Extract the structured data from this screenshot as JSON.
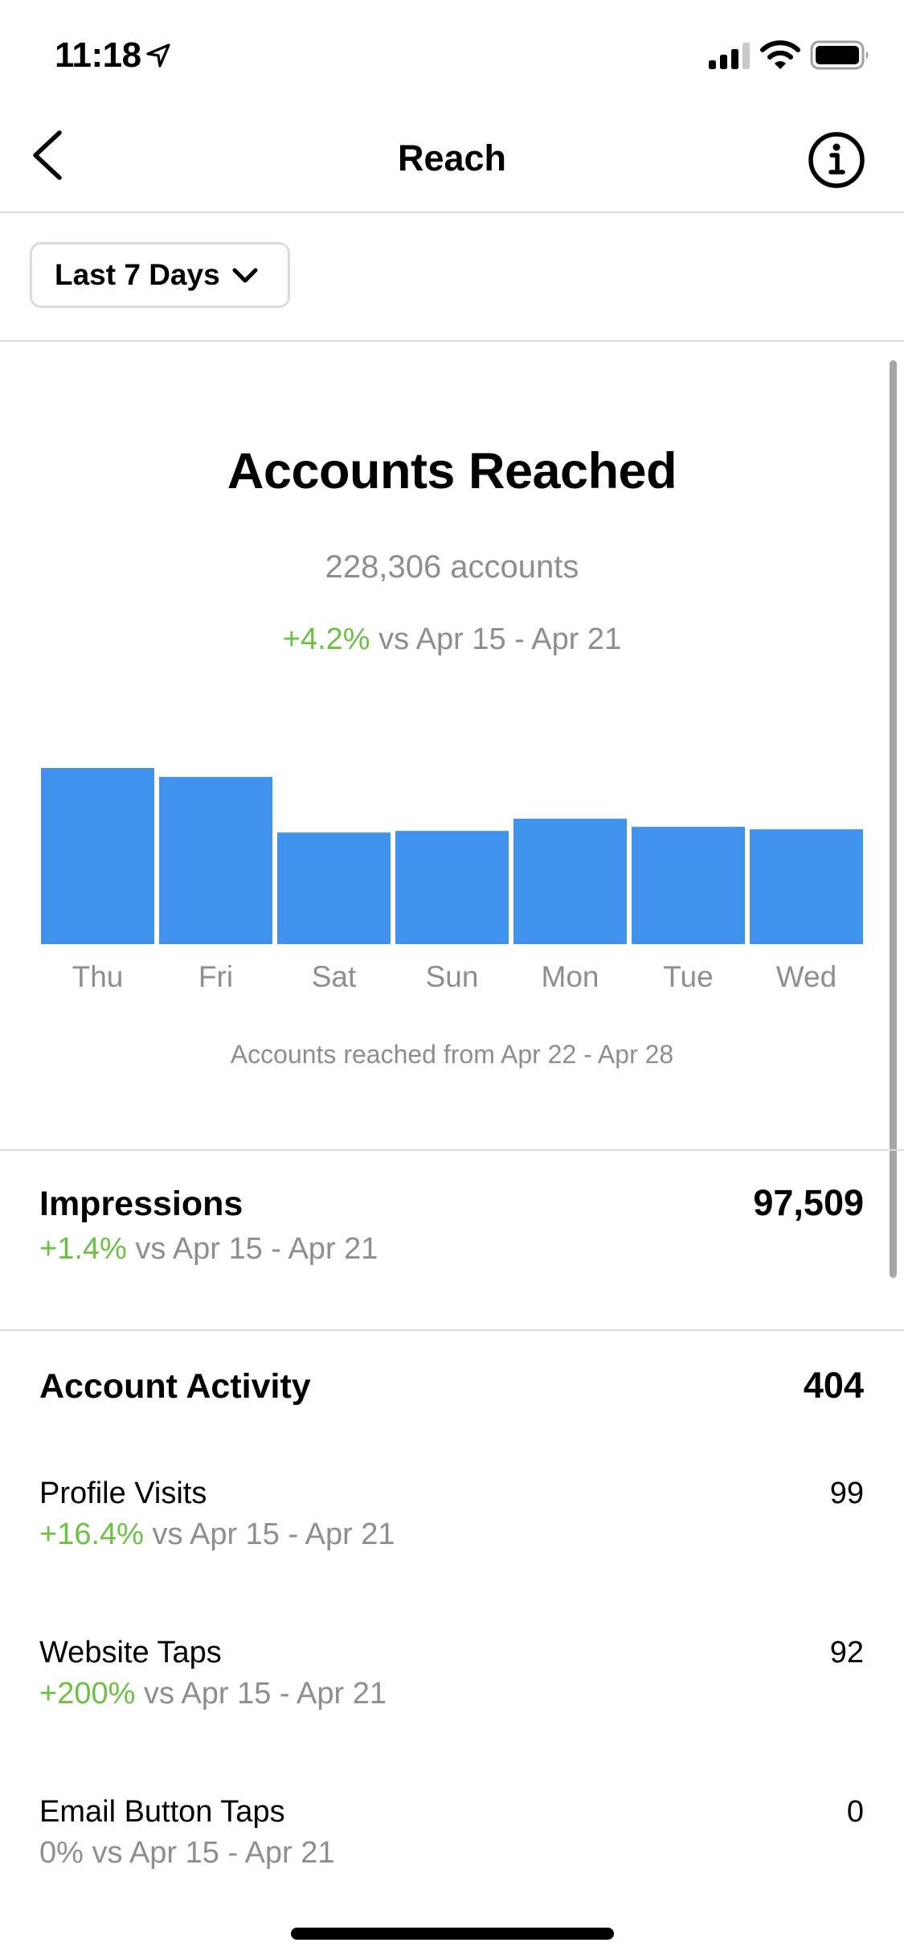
{
  "status_bar": {
    "time": "11:18",
    "icons": [
      "location-arrow-icon",
      "cellular-signal-icon",
      "wifi-icon",
      "battery-icon"
    ]
  },
  "nav": {
    "title": "Reach",
    "back_icon": "chevron-left-icon",
    "info_icon": "info-circle-icon"
  },
  "filter": {
    "selected": "Last 7 Days",
    "icon": "chevron-down-icon"
  },
  "accounts_reached": {
    "title": "Accounts Reached",
    "total": "228,306 accounts",
    "change": "+4.2%",
    "compare": " vs Apr 15 - Apr 21",
    "caption": "Accounts reached from Apr 22 - Apr 28"
  },
  "chart_data": {
    "type": "bar",
    "title": "Accounts Reached",
    "categories": [
      "Thu",
      "Fri",
      "Sat",
      "Sun",
      "Mon",
      "Tue",
      "Wed"
    ],
    "values": [
      43400,
      41200,
      27500,
      27900,
      30900,
      28900,
      28300
    ],
    "xlabel": "",
    "ylabel": "",
    "ylim": [
      0,
      43400
    ],
    "grid": false,
    "color": "#4192ec",
    "caption": "Accounts reached from Apr 22 - Apr 28"
  },
  "impressions": {
    "label": "Impressions",
    "value": "97,509",
    "change": "+1.4%",
    "compare": " vs Apr 15 - Apr 21"
  },
  "account_activity": {
    "label": "Account Activity",
    "value": "404",
    "items": [
      {
        "label": "Profile Visits",
        "value": "99",
        "change": "+16.4%",
        "compare": " vs Apr 15 - Apr 21",
        "positive": true
      },
      {
        "label": "Website Taps",
        "value": "92",
        "change": "+200%",
        "compare": " vs Apr 15 - Apr 21",
        "positive": true
      },
      {
        "label": "Email Button Taps",
        "value": "0",
        "change": "0%",
        "compare": " vs Apr 15 - Apr 21",
        "positive": false
      }
    ]
  },
  "colors": {
    "accent_bar": "#4192ec",
    "positive": "#6cc043",
    "muted_text": "#8e8e8e",
    "divider": "#dbdbdb"
  }
}
